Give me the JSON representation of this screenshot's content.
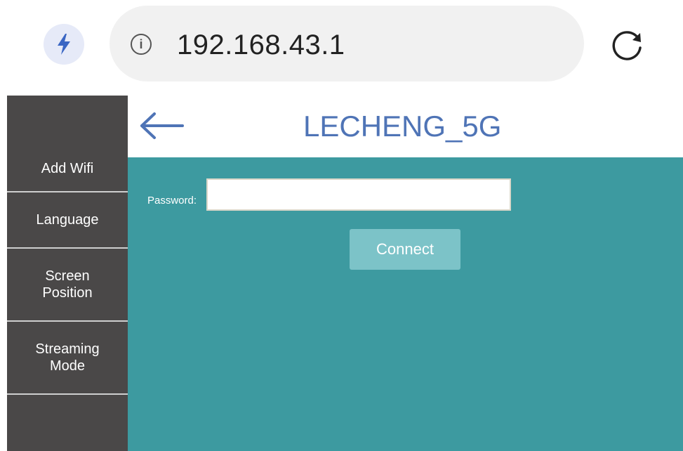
{
  "browser": {
    "url": "192.168.43.1",
    "info_glyph": "i",
    "icons": [
      "bolt-icon",
      "info-icon",
      "reload-icon"
    ]
  },
  "sidebar": {
    "items": [
      {
        "label": "Add Wifi"
      },
      {
        "label": "Language"
      },
      {
        "label": "Screen\nPosition"
      },
      {
        "label": "Streaming\nMode"
      }
    ]
  },
  "header": {
    "title": "LECHENG_5G",
    "back_icon": "arrow-left-icon"
  },
  "form": {
    "password_label": "Password:",
    "password_value": "",
    "connect_label": "Connect"
  },
  "colors": {
    "sidebar_bg": "#4a4848",
    "content_bg": "#3d9aa0",
    "title": "#4f74b6",
    "connect_bg": "#7cc3c8"
  }
}
